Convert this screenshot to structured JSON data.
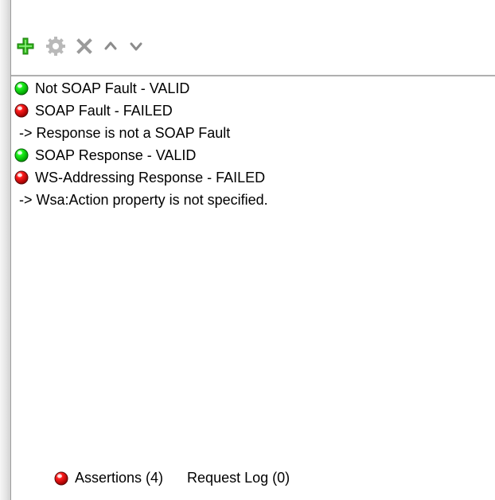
{
  "assertions": [
    {
      "status": "pass",
      "label": "Not SOAP Fault - VALID",
      "detail": null
    },
    {
      "status": "fail",
      "label": "SOAP Fault - FAILED",
      "detail": "-> Response is not a SOAP Fault"
    },
    {
      "status": "pass",
      "label": "SOAP Response - VALID",
      "detail": null
    },
    {
      "status": "fail",
      "label": "WS-Addressing Response - FAILED",
      "detail": "-> Wsa:Action property is not specified."
    }
  ],
  "footer": {
    "assertions_status": "fail",
    "assertions_label": "Assertions (4)",
    "requestlog_label": "Request Log (0)"
  }
}
